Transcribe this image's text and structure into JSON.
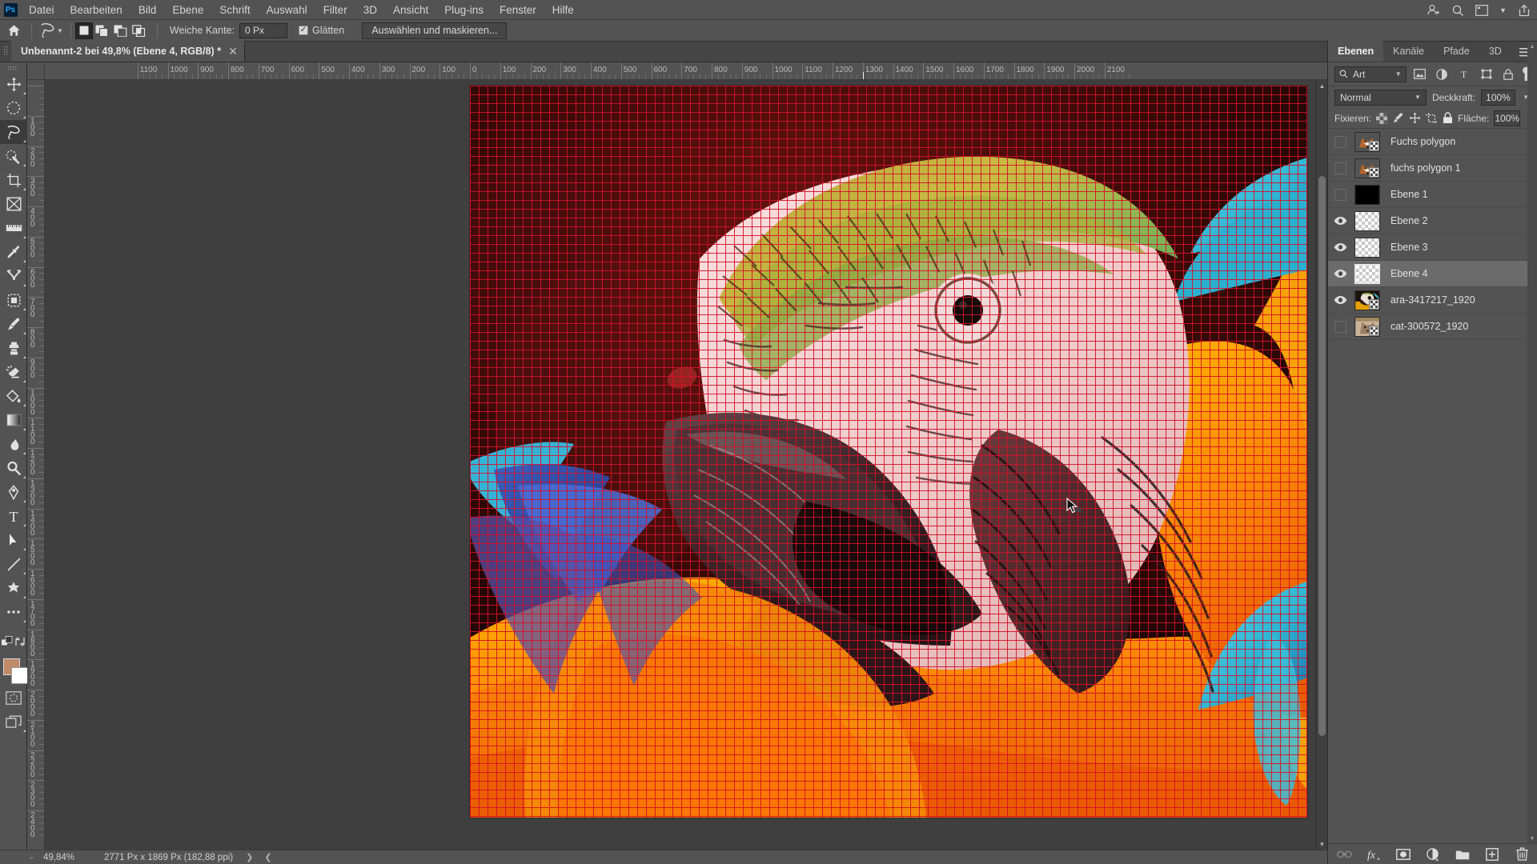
{
  "app": {
    "name": "Photoshop",
    "logo_text": "Ps"
  },
  "menubar": {
    "items": [
      {
        "label": "Datei"
      },
      {
        "label": "Bearbeiten"
      },
      {
        "label": "Bild"
      },
      {
        "label": "Ebene"
      },
      {
        "label": "Schrift"
      },
      {
        "label": "Auswahl"
      },
      {
        "label": "Filter"
      },
      {
        "label": "3D"
      },
      {
        "label": "Ansicht"
      },
      {
        "label": "Plug-ins"
      },
      {
        "label": "Fenster"
      },
      {
        "label": "Hilfe"
      }
    ],
    "right_icons": [
      "user-add-icon",
      "search-icon",
      "workspace-icon",
      "chevron-down-icon",
      "share-icon"
    ]
  },
  "optionsbar": {
    "home_icon": "home-icon",
    "tool_icon": "lasso-tool-icon",
    "selection_modes": [
      "new-selection",
      "add-to-selection",
      "subtract-from-selection",
      "intersect-selection"
    ],
    "active_selection_mode": 0,
    "feather_label": "Weiche Kante:",
    "feather_value": "0 Px",
    "antialias_label": "Glätten",
    "antialias_checked": true,
    "select_mask_button": "Auswählen und maskieren..."
  },
  "document": {
    "tab_title": "Unbenannt-2 bei 49,8% (Ebene 4, RGB/8) *",
    "close_icon": "close-icon"
  },
  "toolbar": {
    "tools": [
      {
        "name": "move-tool",
        "active": false
      },
      {
        "name": "elliptical-marquee-tool",
        "active": false
      },
      {
        "name": "lasso-tool",
        "active": true
      },
      {
        "name": "quick-selection-tool",
        "active": false
      },
      {
        "name": "crop-tool",
        "active": false
      },
      {
        "name": "frame-tool",
        "active": false
      },
      {
        "name": "eyedropper-tool",
        "active": false
      },
      {
        "name": "spot-healing-brush-tool",
        "active": false
      },
      {
        "name": "patch-tool",
        "active": false
      },
      {
        "name": "brush-tool",
        "active": false
      },
      {
        "name": "clone-stamp-tool",
        "active": false
      },
      {
        "name": "eraser-tool",
        "active": false
      },
      {
        "name": "paint-bucket-tool",
        "active": false
      },
      {
        "name": "gradient-tool",
        "active": false
      },
      {
        "name": "blur-tool",
        "active": false
      },
      {
        "name": "dodge-tool",
        "active": false
      },
      {
        "name": "pen-tool",
        "active": false
      },
      {
        "name": "type-tool",
        "active": false
      },
      {
        "name": "path-selection-tool",
        "active": false
      },
      {
        "name": "line-tool",
        "active": false
      },
      {
        "name": "custom-shape-tool",
        "active": false
      },
      {
        "name": "more-tools",
        "active": false
      },
      {
        "name": "quick-mask-mode",
        "active": false
      },
      {
        "name": "screen-mode",
        "active": false
      }
    ],
    "foreground_color": "#bf8a68",
    "background_color": "#ffffff"
  },
  "rulers": {
    "unit": "Px",
    "horizontal_labels": [
      "1100",
      "1000",
      "900",
      "800",
      "700",
      "600",
      "500",
      "400",
      "300",
      "200",
      "100",
      "0",
      "100",
      "200",
      "300",
      "400",
      "500",
      "600",
      "700",
      "800",
      "900",
      "1000",
      "1100",
      "1200",
      "1300",
      "1400",
      "1500",
      "1600",
      "1700",
      "1800",
      "1900",
      "2000"
    ],
    "vertical_labels": [
      "100",
      "200",
      "300",
      "400",
      "500",
      "600",
      "700",
      "800",
      "900",
      "1000",
      "1100",
      "1200",
      "1300",
      "1400",
      "1500",
      "1600",
      "1700",
      "1800",
      "1900"
    ],
    "guide_position_label": "1300"
  },
  "canvas": {
    "subject": "blue-and-gold macaw parrot head",
    "overlay": "red pixel grid",
    "grid_color": "#d61028",
    "background_color": "#000000",
    "cursor_icon": "lasso-cursor"
  },
  "statusbar": {
    "zoom": "49,84%",
    "dimensions": "2771 Px x 1869 Px (182,88 ppi)",
    "next_arrow": "chevron-right-icon",
    "prev_arrow": "chevron-left-icon"
  },
  "layers_panel": {
    "tabs": [
      {
        "label": "Ebenen",
        "active": true
      },
      {
        "label": "Kanäle",
        "active": false
      },
      {
        "label": "Pfade",
        "active": false
      },
      {
        "label": "3D",
        "active": false
      }
    ],
    "menu_icon": "panel-menu-icon",
    "filter": {
      "search_icon": "search-icon",
      "kind_label": "Art",
      "chevron": "chevron-down-icon",
      "filter_icons": [
        "image-filter-icon",
        "adjustment-filter-icon",
        "type-filter-icon",
        "shape-filter-icon",
        "smartobject-filter-icon"
      ],
      "toggle_icon": "filter-toggle-switch"
    },
    "blend": {
      "mode": "Normal",
      "mode_chevron": "chevron-down-icon",
      "opacity_label": "Deckkraft:",
      "opacity_value": "100%"
    },
    "lock": {
      "label": "Fixieren:",
      "icons": [
        "lock-transparency-icon",
        "lock-image-icon",
        "lock-position-icon",
        "lock-artboard-icon",
        "lock-all-icon"
      ],
      "fill_label": "Fläche:",
      "fill_value": "100%"
    },
    "layers": [
      {
        "name": "Fuchs polygon",
        "visible": false,
        "selected": false,
        "thumb": "fox",
        "has_badge": true
      },
      {
        "name": "fuchs polygon 1",
        "visible": false,
        "selected": false,
        "thumb": "fox",
        "has_badge": true
      },
      {
        "name": "Ebene 1",
        "visible": false,
        "selected": false,
        "thumb": "black",
        "has_badge": false
      },
      {
        "name": "Ebene 2",
        "visible": true,
        "selected": false,
        "thumb": "empty",
        "has_badge": false
      },
      {
        "name": "Ebene 3",
        "visible": true,
        "selected": false,
        "thumb": "empty",
        "has_badge": false
      },
      {
        "name": "Ebene 4",
        "visible": true,
        "selected": true,
        "thumb": "empty",
        "has_badge": false
      },
      {
        "name": "ara-3417217_1920",
        "visible": true,
        "selected": false,
        "thumb": "parrot",
        "has_badge": true
      },
      {
        "name": "cat-300572_1920",
        "visible": false,
        "selected": false,
        "thumb": "cat",
        "has_badge": true
      }
    ],
    "bottom_icons": [
      "link-layers-icon",
      "layer-style-fx-icon",
      "layer-mask-icon",
      "adjustment-layer-icon",
      "new-group-icon",
      "new-layer-icon",
      "delete-layer-icon"
    ]
  }
}
